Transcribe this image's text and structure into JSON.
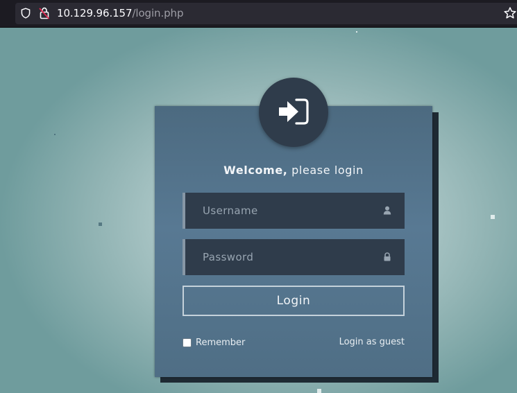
{
  "browser": {
    "url_host": "10.129.96.157",
    "url_path": "/login.php",
    "icons": {
      "tracking": "shield-icon",
      "security": "broken-lock-icon",
      "bookmark": "star-icon"
    }
  },
  "login": {
    "welcome_bold": "Welcome,",
    "welcome_rest": " please login",
    "username_placeholder": "Username",
    "password_placeholder": "Password",
    "login_label": "Login",
    "remember_label": "Remember",
    "guest_label": "Login as guest",
    "icons": {
      "avatar": "sign-in-icon",
      "username": "user-icon",
      "password": "lock-icon"
    }
  },
  "colors": {
    "card": "#587993",
    "field_bg": "#2f3c4b",
    "avatar_bg": "#2f3c4b",
    "text": "#f2f5f8"
  }
}
